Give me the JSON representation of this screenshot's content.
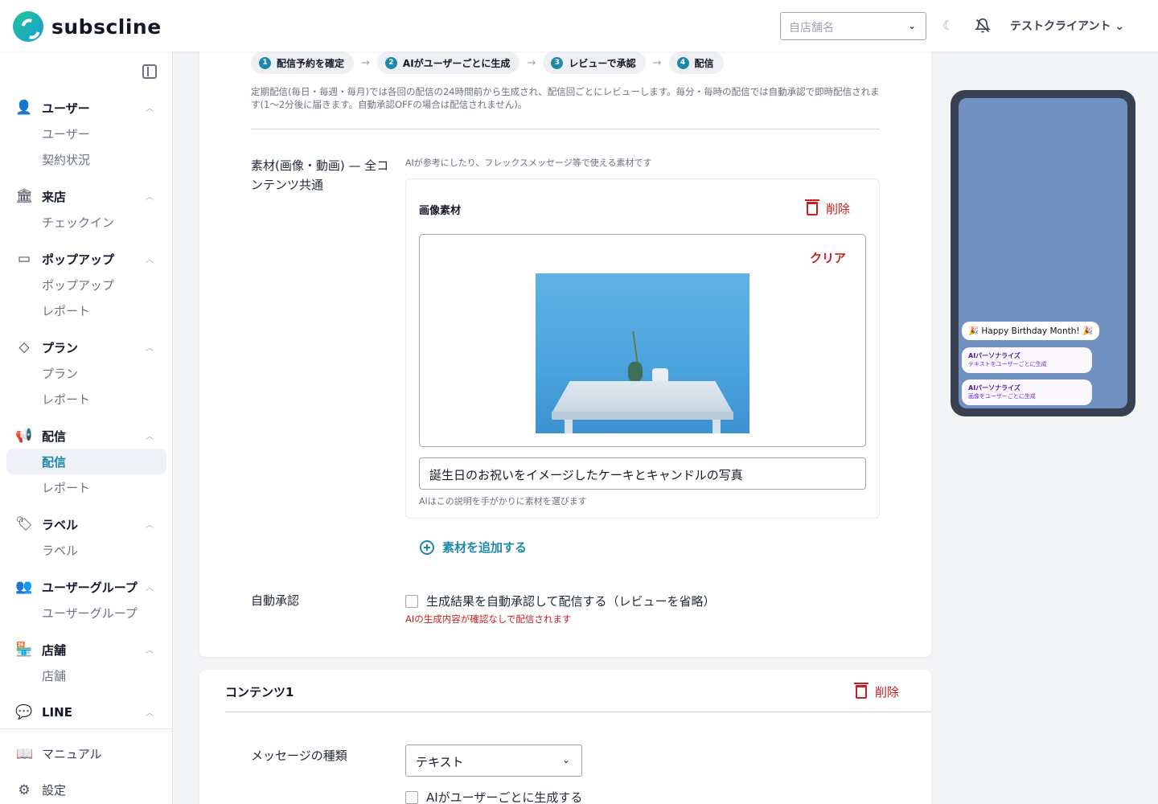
{
  "app": {
    "name": "subscline"
  },
  "header": {
    "store_placeholder": "自店舗名",
    "client_name": "テストクライアント"
  },
  "sidebar": {
    "groups": [
      {
        "label": "ユーザー",
        "icon": "user-icon",
        "items": [
          "ユーザー",
          "契約状況"
        ]
      },
      {
        "label": "来店",
        "icon": "store-front-icon",
        "items": [
          "チェックイン"
        ]
      },
      {
        "label": "ポップアップ",
        "icon": "window-icon",
        "items": [
          "ポップアップ",
          "レポート"
        ]
      },
      {
        "label": "プラン",
        "icon": "diamond-icon",
        "items": [
          "プラン",
          "レポート"
        ]
      },
      {
        "label": "配信",
        "icon": "megaphone-icon",
        "items": [
          "配信",
          "レポート"
        ],
        "active_item": "配信"
      },
      {
        "label": "ラベル",
        "icon": "tag-icon",
        "items": [
          "ラベル"
        ]
      },
      {
        "label": "ユーザーグループ",
        "icon": "users-icon",
        "items": [
          "ユーザーグループ"
        ]
      },
      {
        "label": "店舗",
        "icon": "shop-icon",
        "items": [
          "店舗"
        ]
      },
      {
        "label": "LINE",
        "icon": "chat-icon",
        "items": []
      }
    ],
    "footer": [
      {
        "label": "マニュアル",
        "icon": "book-icon"
      },
      {
        "label": "設定",
        "icon": "gear-icon"
      }
    ]
  },
  "steps": [
    {
      "num": "1",
      "label": "配信予約を確定"
    },
    {
      "num": "2",
      "label": "AIがユーザーごとに生成"
    },
    {
      "num": "3",
      "label": "レビューで承認"
    },
    {
      "num": "4",
      "label": "配信"
    }
  ],
  "note": "定期配信(毎日・毎週・毎月)では各回の配信の24時間前から生成され、配信回ごとにレビューします。毎分・毎時の配信では自動承認で即時配信されます(1〜2分後に届きます。自動承認OFFの場合は配信されません)。",
  "material": {
    "label": "素材(画像・動画) — 全コンテンツ共通",
    "hint": "AIが参考にしたり、フレックスメッセージ等で使える素材です",
    "box_title": "画像素材",
    "delete_label": "削除",
    "clear_label": "クリア",
    "description_value": "誕生日のお祝いをイメージしたケーキとキャンドルの写真",
    "description_hint": "AIはこの説明を手がかりに素材を選びます",
    "add_label": "素材を追加する"
  },
  "auto_approve": {
    "label": "自動承認",
    "checkbox_label": "生成結果を自動承認して配信する（レビューを省略）",
    "warning": "AIの生成内容が確認なしで配信されます"
  },
  "content1": {
    "title": "コンテンツ1",
    "delete_label": "削除",
    "message_type_label": "メッセージの種類",
    "message_type_value": "テキスト",
    "ai_checkbox_label": "AIがユーザーごとに生成する"
  },
  "preview": {
    "bubble1": "🎉 Happy Birthday Month! 🎉",
    "bubble2_title": "AIパーソナライズ",
    "bubble2_sub": "テキストをユーザーごとに生成",
    "bubble3_title": "AIパーソナライズ",
    "bubble3_sub": "画像をユーザーごとに生成"
  }
}
